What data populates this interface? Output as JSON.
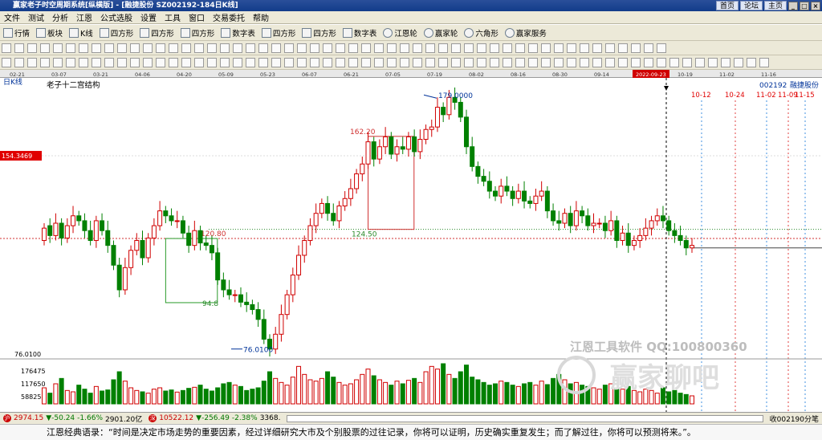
{
  "titlebar": {
    "title": "赢家老子时空周期系统[纵横版] - [融捷股份  SZ002192-184日K线]",
    "links": [
      "首页",
      "论坛",
      "主页"
    ],
    "win_buttons": [
      "_",
      "□",
      "×"
    ]
  },
  "menu": [
    "文件",
    "测试",
    "分析",
    "江恩",
    "公式选股",
    "设置",
    "工具",
    "窗口",
    "交易委托",
    "帮助"
  ],
  "toolbar1": [
    "行情",
    "板块",
    "K线",
    "四方形",
    "四方形",
    "四方形",
    "数字表",
    "四方形",
    "四方形",
    "数字表",
    "江恩轮",
    "赢家轮",
    "六角形",
    "赢家服务"
  ],
  "dates": [
    "02-21",
    "03-07",
    "03-21",
    "04-06",
    "04-20",
    "05-09",
    "05-23",
    "06-07",
    "06-21",
    "07-05",
    "07-19",
    "08-02",
    "08-16",
    "08-30",
    "09-14",
    "2022-09-23",
    "10-19",
    "11-02",
    "11-16"
  ],
  "chart_data": {
    "type": "candlestick",
    "period_label": "日K线",
    "study_title": "老子十二宫结构",
    "code": "002192",
    "name": "融捷股份",
    "cursor_price": "154.3469",
    "high_label": "179.0000",
    "low_label": "76.0100",
    "box_labels": [
      "162.20",
      "124.50",
      "120.80",
      "94.8"
    ],
    "future_dates": [
      "10-12",
      "10-24",
      "11-02",
      "11-09",
      "11-15"
    ],
    "volume_axis": [
      "176475",
      "117650",
      "58825"
    ],
    "price_axis_low": "76.0100",
    "watermarks": [
      "江恩工具软件 QQ:100800360",
      "赢家聊吧"
    ],
    "closes": [
      125,
      122,
      127,
      121,
      126,
      130,
      128,
      124,
      120,
      128,
      124,
      118,
      110,
      100,
      109,
      116,
      120,
      113,
      121,
      126,
      132,
      130,
      128,
      128,
      123,
      118,
      124,
      119,
      118,
      115,
      104,
      100,
      98,
      98,
      95,
      94,
      92,
      88,
      80,
      76,
      82,
      90,
      98,
      106,
      114,
      120,
      126,
      131,
      135,
      131,
      128,
      134,
      137,
      141,
      147,
      151,
      160,
      153,
      158,
      162,
      155,
      158,
      157,
      162,
      156,
      161,
      165,
      166,
      174,
      171,
      178,
      176,
      170,
      158,
      150,
      146,
      144,
      140,
      138,
      142,
      140,
      137,
      140,
      136,
      135,
      138,
      140,
      132,
      128,
      127,
      131,
      126,
      132,
      130,
      126,
      127,
      127,
      124,
      128,
      120,
      123,
      118,
      120,
      122,
      125,
      128,
      130,
      128,
      124,
      122,
      120,
      117,
      118
    ],
    "opens": [
      120,
      126,
      122,
      127,
      121,
      126,
      130,
      128,
      124,
      120,
      128,
      124,
      118,
      110,
      100,
      109,
      116,
      120,
      113,
      121,
      126,
      132,
      130,
      128,
      128,
      123,
      118,
      124,
      119,
      118,
      115,
      104,
      100,
      98,
      98,
      95,
      94,
      92,
      88,
      80,
      76,
      82,
      90,
      98,
      106,
      114,
      120,
      126,
      131,
      135,
      131,
      128,
      134,
      137,
      141,
      147,
      151,
      160,
      153,
      158,
      162,
      155,
      158,
      157,
      162,
      156,
      161,
      165,
      166,
      174,
      171,
      178,
      176,
      170,
      158,
      150,
      146,
      144,
      140,
      138,
      142,
      140,
      137,
      140,
      136,
      135,
      138,
      140,
      132,
      128,
      127,
      131,
      126,
      132,
      130,
      126,
      127,
      127,
      124,
      128,
      120,
      123,
      118,
      120,
      122,
      125,
      128,
      130,
      128,
      124,
      122,
      120,
      117
    ],
    "volumes": [
      60,
      40,
      75,
      95,
      50,
      45,
      70,
      55,
      40,
      65,
      48,
      52,
      90,
      120,
      85,
      60,
      50,
      45,
      40,
      55,
      60,
      48,
      52,
      44,
      50,
      58,
      62,
      70,
      55,
      48,
      60,
      75,
      80,
      70,
      65,
      50,
      55,
      60,
      85,
      120,
      95,
      80,
      70,
      100,
      140,
      110,
      90,
      85,
      95,
      120,
      100,
      80,
      70,
      75,
      90,
      110,
      130,
      105,
      90,
      80,
      70,
      85,
      75,
      88,
      95,
      80,
      120,
      140,
      130,
      150,
      110,
      95,
      120,
      145,
      100,
      90,
      80,
      70,
      75,
      85,
      80,
      70,
      65,
      75,
      80,
      70,
      85,
      72,
      95,
      110,
      90,
      75,
      80,
      70,
      65,
      60,
      55,
      70,
      75,
      60,
      55,
      65,
      50,
      45,
      55,
      50,
      40,
      60,
      45,
      50,
      40,
      35,
      30
    ],
    "ylim": [
      72,
      182
    ]
  },
  "status": {
    "sh_index": "2974.15",
    "sh_change": "-50.24",
    "sh_pct": "-1.66%",
    "sh_amount": "2901.20亿",
    "sz_index": "10522.12",
    "sz_change": "-256.49",
    "sz_pct": "-2.38%",
    "sz_amount": "3368.",
    "right_text": "收002190分笔"
  },
  "quote": "江恩经典语录：“时间是决定市场走势的重要因素，经过详细研究大市及个别股票的过往记录，你将可以证明，历史确实重复发生；而了解过往，你将可以预测将来。”。"
}
